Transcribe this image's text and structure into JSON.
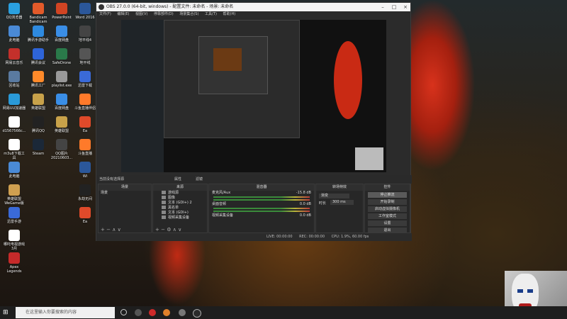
{
  "desktop": {
    "icons": [
      {
        "label": "QQ浏览器",
        "color": "#2aa0e0"
      },
      {
        "label": "Bandicam Bandicam",
        "color": "#e25a2a"
      },
      {
        "label": "PowerPoint",
        "color": "#d04423"
      },
      {
        "label": "Word 2016",
        "color": "#2b579a"
      },
      {
        "label": "此电脑",
        "color": "#4a8ad6"
      },
      {
        "label": "腾讯手游助手",
        "color": "#2e8ae0"
      },
      {
        "label": "百度网盘",
        "color": "#3a8ee6"
      },
      {
        "label": "地平线4",
        "color": "#444444"
      },
      {
        "label": "网易云音乐",
        "color": "#c4302b"
      },
      {
        "label": "腾讯会议",
        "color": "#2e64d8"
      },
      {
        "label": "SafeDrone",
        "color": "#2a7a4a"
      },
      {
        "label": "地平线",
        "color": "#555555"
      },
      {
        "label": "回收站",
        "color": "#5a7aa0"
      },
      {
        "label": "腾讯工厂",
        "color": "#ff8a2a"
      },
      {
        "label": "playlist.exe",
        "color": "#999999"
      },
      {
        "label": "迅雷下载",
        "color": "#3a6ad8"
      },
      {
        "label": "网易UU加速器",
        "color": "#2a9ad8"
      },
      {
        "label": "英雄联盟",
        "color": "#c8a24a"
      },
      {
        "label": "百度网盘",
        "color": "#3a8ee6"
      },
      {
        "label": "斗鱼直播伴侣",
        "color": "#ff7a2a"
      },
      {
        "label": "Ea",
        "color": "#e04a2a"
      },
      {
        "label": "d1567566c...",
        "color": "#ffffff"
      },
      {
        "label": "腾讯QQ",
        "color": "#222222"
      },
      {
        "label": "英雄联盟",
        "color": "#c8a24a"
      },
      {
        "label": "斗鱼直播",
        "color": "#ff7a2a"
      },
      {
        "label": "Wi",
        "color": "#2b579a"
      },
      {
        "label": "m3u8下载工具",
        "color": "#ffffff"
      },
      {
        "label": "Steam",
        "color": "#1b2838"
      },
      {
        "label": "QQ图片 20210603...",
        "color": "#444444"
      },
      {
        "label": "永劫无间",
        "color": "#222222"
      },
      {
        "label": "Ea",
        "color": "#e04a2a"
      },
      {
        "label": "此电脑",
        "color": "#4a8ad6"
      },
      {
        "label": "英雄联盟 WeGame版",
        "color": "#d0a050"
      },
      {
        "label": "迅雷手游",
        "color": "#3a6ad8"
      },
      {
        "label": "哪吒电视游戏 3月",
        "color": "#ffffff"
      },
      {
        "label": "Apex Legends",
        "color": "#c62a2a"
      }
    ]
  },
  "taskbar": {
    "search_placeholder": "在这里输入你要搜索的内容"
  },
  "obs": {
    "title": "OBS 27.0.0 (64-bit, windows) - 配置文件: 未命名 - 场景: 未命名",
    "menu": [
      "文件(F)",
      "编辑(E)",
      "视图(V)",
      "停靠部件(D)",
      "场景集合(S)",
      "工具(T)",
      "帮助(H)"
    ],
    "status": {
      "no_source": "当前没有选择源",
      "props": "属性",
      "filters": "滤镜"
    },
    "scenes": {
      "header": "场景",
      "items": [
        "场景"
      ]
    },
    "sources": {
      "header": "来源",
      "items": [
        "游戏源",
        "图像",
        "文本 (GDI+) 2",
        "黑名单",
        "文本 (GDI+)",
        "视频采集设备"
      ]
    },
    "mixer": {
      "header": "混音器",
      "channels": [
        {
          "name": "麦克风/Aux",
          "db": "-15.8 dB"
        },
        {
          "name": "桌面音频",
          "db": "0.0 dB"
        },
        {
          "name": "视频采集设备",
          "db": "0.0 dB"
        }
      ]
    },
    "transitions": {
      "header": "转场特效",
      "type": "渐变",
      "duration_label": "时长",
      "duration": "300 ms"
    },
    "controls": {
      "header": "控件",
      "buttons": [
        "停止推流",
        "开始录制",
        "启动虚拟摄像机",
        "工作室模式",
        "设置",
        "退出"
      ]
    },
    "bottom": {
      "live": "LIVE: 00:00:00",
      "rec": "REC: 00:00:00",
      "cpu": "CPU: 1.9%, 60.00 fps"
    }
  }
}
